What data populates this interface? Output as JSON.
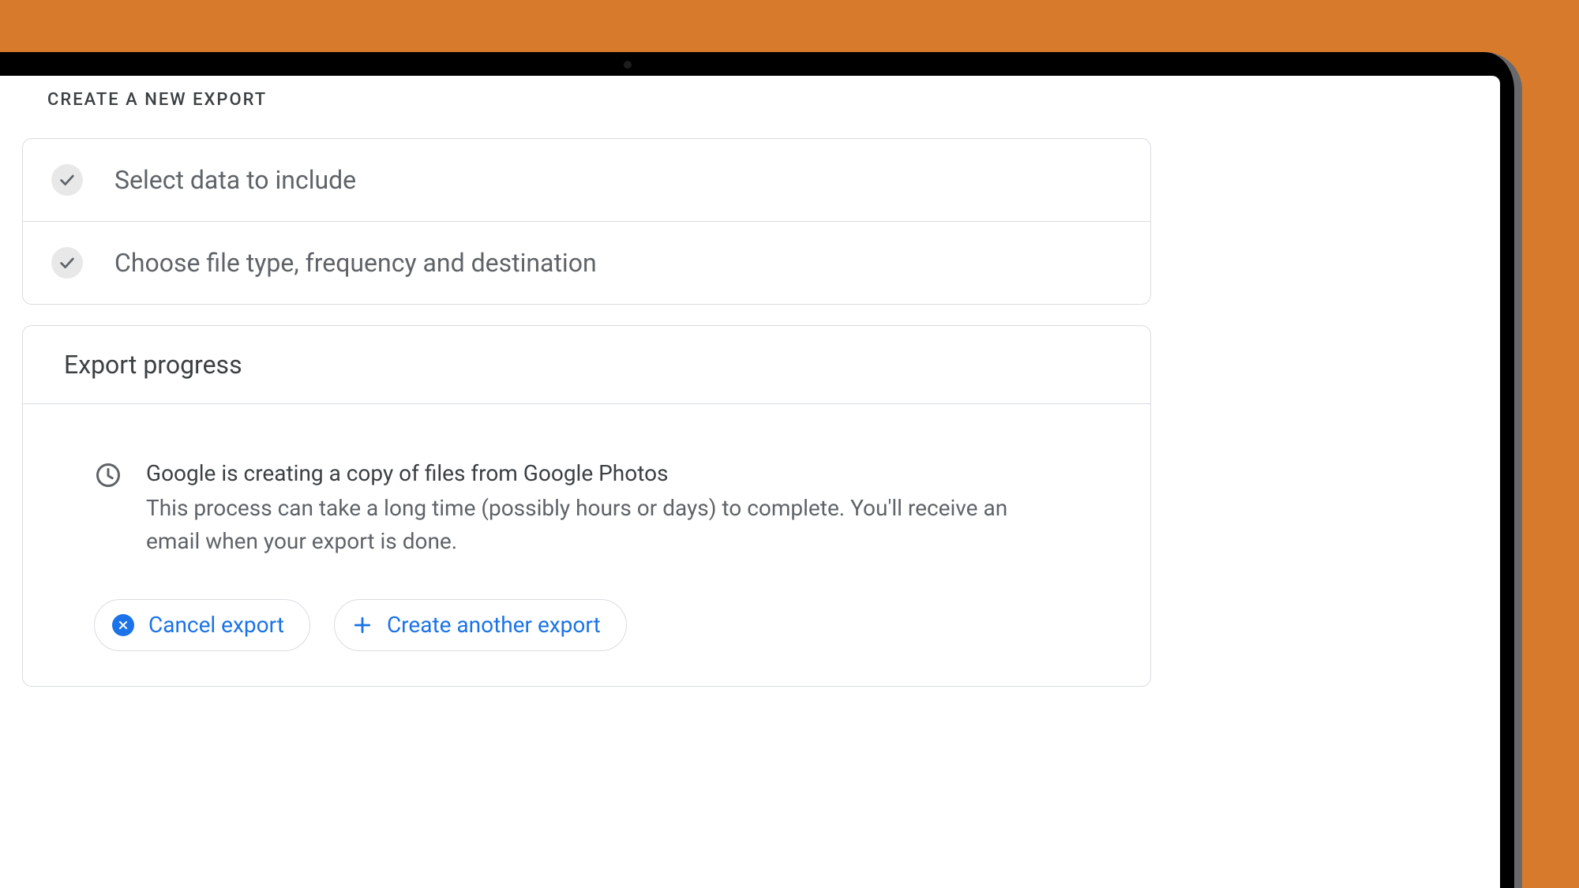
{
  "page": {
    "heading": "CREATE A NEW EXPORT"
  },
  "steps": [
    {
      "label": "Select data to include"
    },
    {
      "label": "Choose file type, frequency and destination"
    }
  ],
  "progress": {
    "title": "Export progress",
    "status_headline": "Google is creating a copy of files from Google Photos",
    "status_detail": "This process can take a long time (possibly hours or days) to complete. You'll receive an email when your export is done."
  },
  "buttons": {
    "cancel": "Cancel export",
    "create_another": "Create another export"
  },
  "colors": {
    "accent": "#1a73e8",
    "border": "#dadce0",
    "text_primary": "#3c4043",
    "text_secondary": "#5f6368",
    "background_stage": "#d87a2b"
  }
}
